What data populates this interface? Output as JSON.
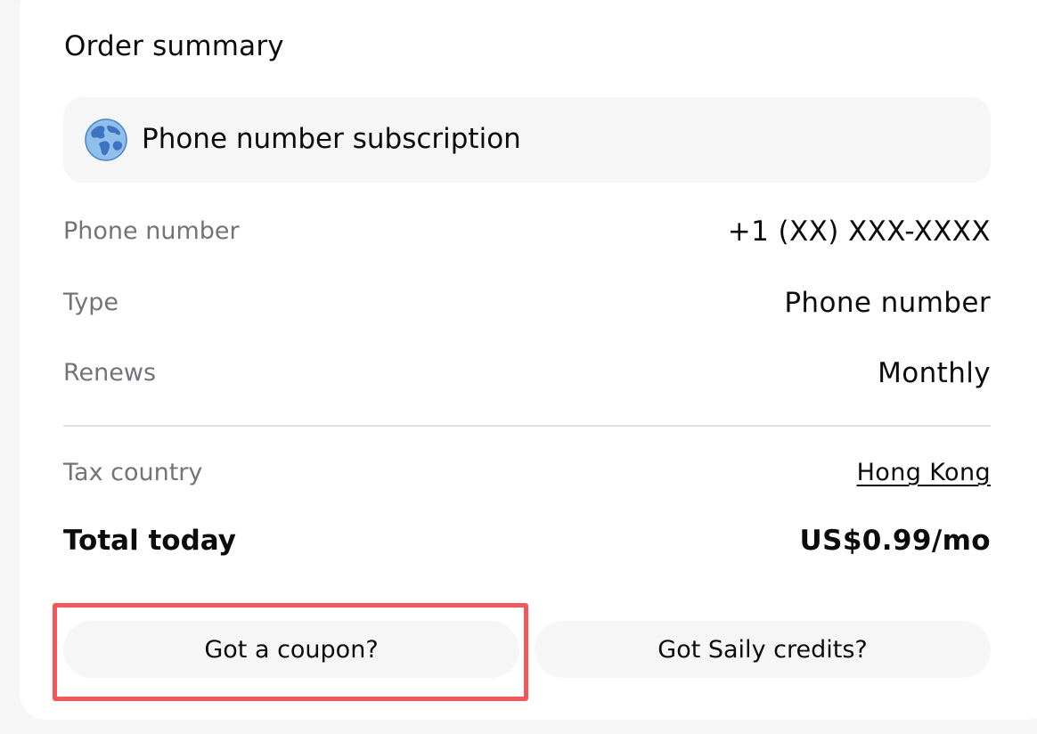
{
  "order_summary": {
    "title": "Order summary",
    "product": {
      "icon": "globe-icon",
      "label": "Phone number subscription"
    },
    "details": [
      {
        "label": "Phone number",
        "value": "+1 (XX) XXX-XXXX"
      },
      {
        "label": "Type",
        "value": "Phone number"
      },
      {
        "label": "Renews",
        "value": "Monthly"
      }
    ],
    "tax": {
      "label": "Tax country",
      "value": "Hong Kong"
    },
    "total": {
      "label": "Total today",
      "value": "US$0.99/mo"
    },
    "buttons": {
      "coupon": "Got a coupon?",
      "credits": "Got Saily credits?"
    }
  },
  "colors": {
    "highlight": "#f2575a",
    "muted_text": "#73737a",
    "surface": "#f6f6f6"
  }
}
